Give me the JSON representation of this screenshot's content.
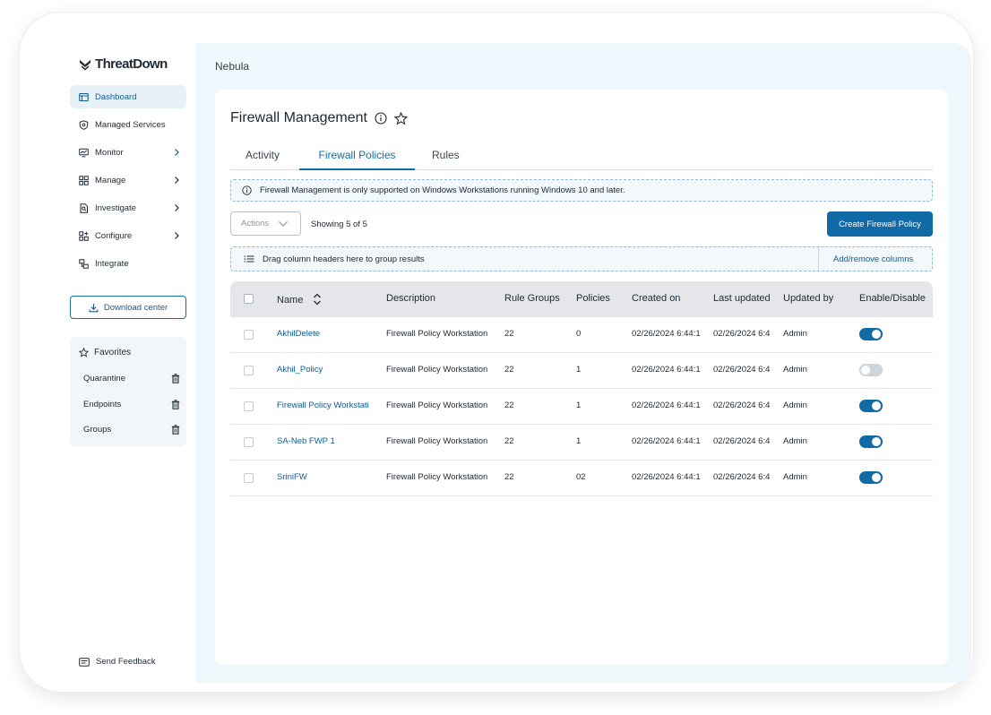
{
  "app": {
    "brand": "ThreatDown",
    "workspace": "Nebula"
  },
  "sidebar": {
    "items": [
      {
        "label": "Dashboard",
        "icon": "dashboard-icon",
        "active": true,
        "chevron": false
      },
      {
        "label": "Managed Services",
        "icon": "shield-icon",
        "active": false,
        "chevron": false
      },
      {
        "label": "Monitor",
        "icon": "monitor-icon",
        "active": false,
        "chevron": true
      },
      {
        "label": "Manage",
        "icon": "grid-icon",
        "active": false,
        "chevron": true
      },
      {
        "label": "Investigate",
        "icon": "investigate-icon",
        "active": false,
        "chevron": true
      },
      {
        "label": "Configure",
        "icon": "configure-icon",
        "active": false,
        "chevron": true
      },
      {
        "label": "Integrate",
        "icon": "integrate-icon",
        "active": false,
        "chevron": false
      }
    ],
    "download_label": "Download center",
    "favorites": {
      "title": "Favorites",
      "items": [
        {
          "label": "Quarantine"
        },
        {
          "label": "Endpoints"
        },
        {
          "label": "Groups"
        }
      ]
    },
    "feedback_label": "Send Feedback"
  },
  "page": {
    "title": "Firewall Management",
    "tabs": [
      {
        "label": "Activity",
        "active": false
      },
      {
        "label": "Firewall Policies",
        "active": true
      },
      {
        "label": "Rules",
        "active": false
      }
    ],
    "banner_text": "Firewall Management is only supported on Windows Workstations running Windows 10 and later.",
    "actions_label": "Actions",
    "showing_text": "Showing 5 of 5",
    "create_label": "Create Firewall Policy",
    "group_hint": "Drag column headers here to group results",
    "add_remove_label": "Add/remove columns"
  },
  "table": {
    "columns": [
      "Name",
      "Description",
      "Rule Groups",
      "Policies",
      "Created on",
      "Last updated",
      "Updated by",
      "Enable/Disable"
    ],
    "rows": [
      {
        "name": "AkhilDelete",
        "description": "Firewall Policy Workstation",
        "rule_groups": "22",
        "policies": "0",
        "created": "02/26/2024 6:44:1",
        "updated": "02/26/2024 6:4",
        "updated_by": "Admin",
        "enabled": true
      },
      {
        "name": "Akhil_Policy",
        "description": "Firewall Policy Workstation",
        "rule_groups": "22",
        "policies": "1",
        "created": "02/26/2024 6:44:1",
        "updated": "02/26/2024 6:4",
        "updated_by": "Admin",
        "enabled": false
      },
      {
        "name": "Firewall Policy Workstati",
        "description": "Firewall Policy Workstation",
        "rule_groups": "22",
        "policies": "1",
        "created": "02/26/2024 6:44:1",
        "updated": "02/26/2024 6:4",
        "updated_by": "Admin",
        "enabled": true
      },
      {
        "name": "SA-Neb FWP 1",
        "description": "Firewall Policy Workstation",
        "rule_groups": "22",
        "policies": "1",
        "created": "02/26/2024 6:44:1",
        "updated": "02/26/2024 6:4",
        "updated_by": "Admin",
        "enabled": true
      },
      {
        "name": "SriniFW",
        "description": "Firewall Policy Workstation",
        "rule_groups": "22",
        "policies": "02",
        "created": "02/26/2024 6:44:1",
        "updated": "02/26/2024 6:4",
        "updated_by": "Admin",
        "enabled": true
      }
    ]
  },
  "colors": {
    "accent": "#0f6aa5",
    "link": "#0f5d92",
    "main_bg": "#eef7fc",
    "active_nav_bg": "#e7f1f8"
  }
}
